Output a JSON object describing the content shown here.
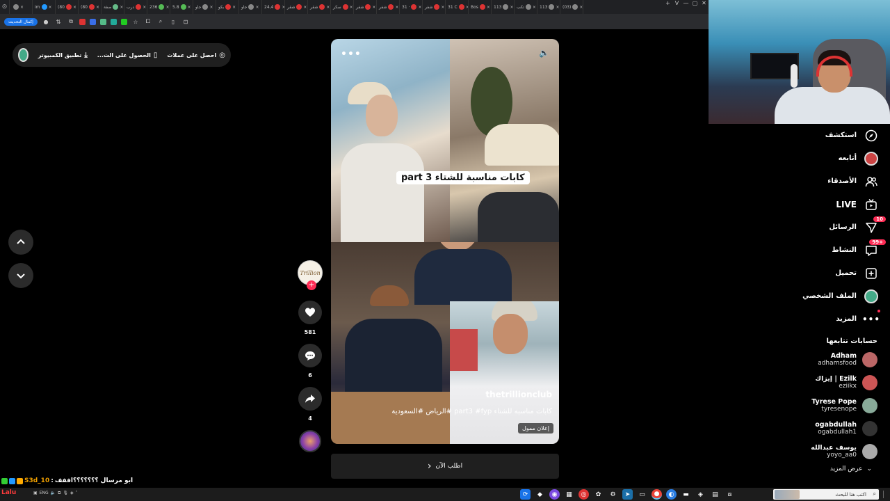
{
  "browser": {
    "tabs": [
      "",
      "im",
      "(80",
      "(80",
      "صفة",
      "درب",
      "236",
      "5.8",
      "جاو",
      "بكو",
      "جاو",
      "24,4",
      "شقر",
      "شقر",
      "سكر",
      "شفر",
      "شفر",
      "31 ·",
      "شفر",
      "31 C",
      "Bos",
      "113",
      "تكب",
      "113",
      "(03)"
    ],
    "update_button": "إكمال التحديث",
    "window_controls": [
      "+",
      "ᐯ",
      "—",
      "▢",
      "✕"
    ]
  },
  "topbar": {
    "get_coins": "احصل على عملات",
    "get_app": "الحصول على الت...",
    "desktop_app": "تطبيق الكمبيوتر"
  },
  "video": {
    "title_overlay": "كابات مناسبة للشتاء part 3",
    "username": "thetrillionclub",
    "caption": "كابات مناسبه للشتاء part3 #fyp #الرياض #السعودية",
    "ad_badge": "إعلان ممول",
    "more_glyph": "•••",
    "sound_glyph": "🔈"
  },
  "cta": {
    "label": "اطلب الآن",
    "glyph": "‹"
  },
  "actions": {
    "author_logo": "Trillion",
    "likes": "581",
    "comments": "6",
    "shares": "4"
  },
  "sidebar": {
    "nav": [
      {
        "label": "استكشف",
        "icon": "compass-icon"
      },
      {
        "label": "أتابعه",
        "icon": "avatar"
      },
      {
        "label": "الأصدقاء",
        "icon": "friends-icon"
      },
      {
        "label": "LIVE",
        "icon": "live-icon"
      },
      {
        "label": "الرسائل",
        "icon": "messages-icon",
        "badge": "10"
      },
      {
        "label": "النشاط",
        "icon": "activity-icon",
        "badge": "99+"
      },
      {
        "label": "تحميل",
        "icon": "upload-icon"
      },
      {
        "label": "الملف الشخصي",
        "icon": "profile-avatar"
      },
      {
        "label": "المزيد",
        "icon": "more-icon"
      }
    ],
    "following_title": "حسابات تتابعها",
    "following": [
      {
        "name": "Adham",
        "handle": "adhamsfood",
        "color": "#b66"
      },
      {
        "name": "Ezilk | إيزاك",
        "handle": "eziikx",
        "color": "#c55"
      },
      {
        "name": "Tyrese Pope",
        "handle": "tyresenope",
        "color": "#8a9"
      },
      {
        "name": "ogabdullah",
        "handle": "ogabdullah1",
        "color": "#333"
      },
      {
        "name": "يوسف عبدالله",
        "handle": "yoyo_aa0",
        "color": "#aaa"
      }
    ],
    "see_more": "عرض المزيد"
  },
  "chat": {
    "user": "S3d_10",
    "message": "ابو مرسال ؟؟؟؟؟؟؟اففف",
    "user2": "Lalu"
  },
  "taskbar": {
    "search_placeholder": "اكتب هنا للبحث",
    "lang": "ENG"
  }
}
